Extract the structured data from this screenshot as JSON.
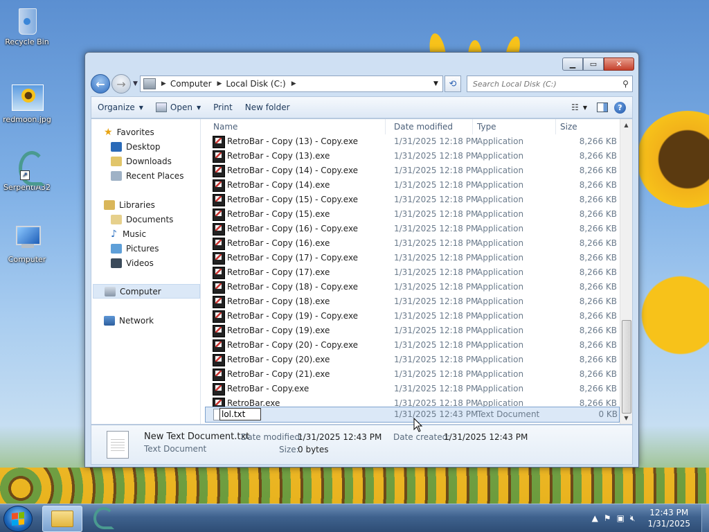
{
  "desktop": {
    "icons": [
      {
        "label": "Recycle Bin"
      },
      {
        "label": "redmoon.jpg"
      },
      {
        "label": "SerpentIA32"
      },
      {
        "label": "Computer"
      }
    ]
  },
  "window": {
    "address": {
      "seg1": "Computer",
      "seg2": "Local Disk (C:)"
    },
    "search_placeholder": "Search Local Disk (C:)",
    "toolbar": {
      "organize": "Organize",
      "open": "Open",
      "print": "Print",
      "new_folder": "New folder"
    },
    "nav": {
      "favorites": "Favorites",
      "desktop": "Desktop",
      "downloads": "Downloads",
      "recent": "Recent Places",
      "libraries": "Libraries",
      "documents": "Documents",
      "music": "Music",
      "pictures": "Pictures",
      "videos": "Videos",
      "computer": "Computer",
      "network": "Network"
    },
    "columns": {
      "name": "Name",
      "date": "Date modified",
      "type": "Type",
      "size": "Size"
    },
    "files": [
      {
        "name": "RetroBar - Copy (13) - Copy.exe",
        "date": "1/31/2025 12:18 PM",
        "type": "Application",
        "size": "8,266 KB"
      },
      {
        "name": "RetroBar - Copy (13).exe",
        "date": "1/31/2025 12:18 PM",
        "type": "Application",
        "size": "8,266 KB"
      },
      {
        "name": "RetroBar - Copy (14) - Copy.exe",
        "date": "1/31/2025 12:18 PM",
        "type": "Application",
        "size": "8,266 KB"
      },
      {
        "name": "RetroBar - Copy (14).exe",
        "date": "1/31/2025 12:18 PM",
        "type": "Application",
        "size": "8,266 KB"
      },
      {
        "name": "RetroBar - Copy (15) - Copy.exe",
        "date": "1/31/2025 12:18 PM",
        "type": "Application",
        "size": "8,266 KB"
      },
      {
        "name": "RetroBar - Copy (15).exe",
        "date": "1/31/2025 12:18 PM",
        "type": "Application",
        "size": "8,266 KB"
      },
      {
        "name": "RetroBar - Copy (16) - Copy.exe",
        "date": "1/31/2025 12:18 PM",
        "type": "Application",
        "size": "8,266 KB"
      },
      {
        "name": "RetroBar - Copy (16).exe",
        "date": "1/31/2025 12:18 PM",
        "type": "Application",
        "size": "8,266 KB"
      },
      {
        "name": "RetroBar - Copy (17) - Copy.exe",
        "date": "1/31/2025 12:18 PM",
        "type": "Application",
        "size": "8,266 KB"
      },
      {
        "name": "RetroBar - Copy (17).exe",
        "date": "1/31/2025 12:18 PM",
        "type": "Application",
        "size": "8,266 KB"
      },
      {
        "name": "RetroBar - Copy (18) - Copy.exe",
        "date": "1/31/2025 12:18 PM",
        "type": "Application",
        "size": "8,266 KB"
      },
      {
        "name": "RetroBar - Copy (18).exe",
        "date": "1/31/2025 12:18 PM",
        "type": "Application",
        "size": "8,266 KB"
      },
      {
        "name": "RetroBar - Copy (19) - Copy.exe",
        "date": "1/31/2025 12:18 PM",
        "type": "Application",
        "size": "8,266 KB"
      },
      {
        "name": "RetroBar - Copy (19).exe",
        "date": "1/31/2025 12:18 PM",
        "type": "Application",
        "size": "8,266 KB"
      },
      {
        "name": "RetroBar - Copy (20) - Copy.exe",
        "date": "1/31/2025 12:18 PM",
        "type": "Application",
        "size": "8,266 KB"
      },
      {
        "name": "RetroBar - Copy (20).exe",
        "date": "1/31/2025 12:18 PM",
        "type": "Application",
        "size": "8,266 KB"
      },
      {
        "name": "RetroBar - Copy (21).exe",
        "date": "1/31/2025 12:18 PM",
        "type": "Application",
        "size": "8,266 KB"
      },
      {
        "name": "RetroBar - Copy.exe",
        "date": "1/31/2025 12:18 PM",
        "type": "Application",
        "size": "8,266 KB"
      },
      {
        "name": "RetroBar.exe",
        "date": "1/31/2025 12:18 PM",
        "type": "Application",
        "size": "8,266 KB"
      }
    ],
    "editing_file": {
      "name_value": "lol.txt",
      "date": "1/31/2025 12:43 PM",
      "type": "Text Document",
      "size": "0 KB"
    },
    "details": {
      "filename": "New Text Document.txt",
      "filetype": "Text Document",
      "modified_label": "Date modified:",
      "modified_value": "1/31/2025 12:43 PM",
      "created_label": "Date created:",
      "created_value": "1/31/2025 12:43 PM",
      "size_label": "Size:",
      "size_value": "0 bytes"
    }
  },
  "taskbar": {
    "time": "12:43 PM",
    "date": "1/31/2025"
  }
}
